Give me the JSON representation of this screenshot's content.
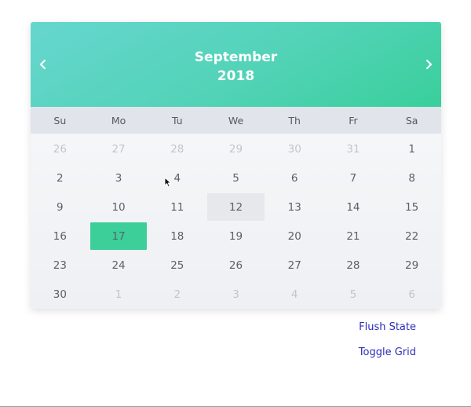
{
  "calendar": {
    "month": "September",
    "year": "2018",
    "weekdays": [
      "Su",
      "Mo",
      "Tu",
      "We",
      "Th",
      "Fr",
      "Sa"
    ],
    "days": [
      {
        "label": "26",
        "outside": true
      },
      {
        "label": "27",
        "outside": true
      },
      {
        "label": "28",
        "outside": true
      },
      {
        "label": "29",
        "outside": true
      },
      {
        "label": "30",
        "outside": true
      },
      {
        "label": "31",
        "outside": true
      },
      {
        "label": "1"
      },
      {
        "label": "2"
      },
      {
        "label": "3"
      },
      {
        "label": "4"
      },
      {
        "label": "5"
      },
      {
        "label": "6"
      },
      {
        "label": "7"
      },
      {
        "label": "8"
      },
      {
        "label": "9"
      },
      {
        "label": "10"
      },
      {
        "label": "11"
      },
      {
        "label": "12",
        "today": true
      },
      {
        "label": "13"
      },
      {
        "label": "14"
      },
      {
        "label": "15"
      },
      {
        "label": "16"
      },
      {
        "label": "17",
        "selected": true
      },
      {
        "label": "18"
      },
      {
        "label": "19"
      },
      {
        "label": "20"
      },
      {
        "label": "21"
      },
      {
        "label": "22"
      },
      {
        "label": "23"
      },
      {
        "label": "24"
      },
      {
        "label": "25"
      },
      {
        "label": "26"
      },
      {
        "label": "27"
      },
      {
        "label": "28"
      },
      {
        "label": "29"
      },
      {
        "label": "30"
      },
      {
        "label": "1",
        "outside": true
      },
      {
        "label": "2",
        "outside": true
      },
      {
        "label": "3",
        "outside": true
      },
      {
        "label": "4",
        "outside": true
      },
      {
        "label": "5",
        "outside": true
      },
      {
        "label": "6",
        "outside": true
      }
    ]
  },
  "links": {
    "flush_state": "Flush State",
    "toggle_grid": "Toggle Grid"
  },
  "icons": {
    "prev": "chevron-left-icon",
    "next": "chevron-right-icon",
    "cursor": "mouse-pointer-icon"
  },
  "colors": {
    "header_gradient_start": "#66d6cf",
    "header_gradient_end": "#39cf9b",
    "selected_day": "#3ccf99",
    "today_day": "#e6e8ec",
    "link": "#2b2bb8"
  }
}
